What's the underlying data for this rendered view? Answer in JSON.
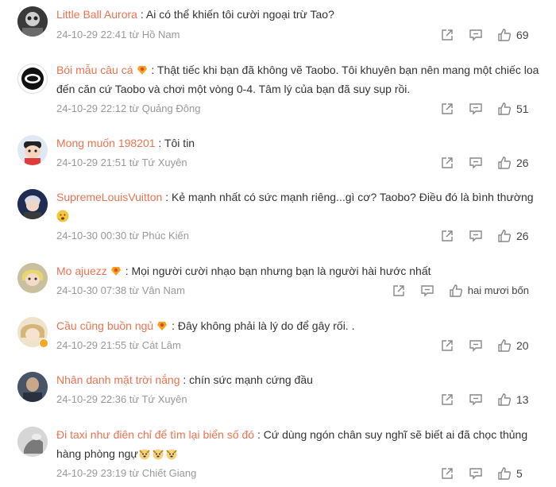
{
  "comments": [
    {
      "user": "Little Ball Aurora",
      "sep": " : ",
      "text": "Ai có thể khiến tôi cười ngoại trừ Tao?",
      "time": "24-10-29 22:41 từ Hồ Nam",
      "likes": "69",
      "badge": false,
      "emojis": []
    },
    {
      "user": "Bói mẫu câu cá",
      "sep": " : ",
      "text": "Thật tiếc khi bạn đã không vẽ Taobo. Tôi khuyên bạn nên mang một chiếc loa đến căn cứ Taobo và chơi một vòng 0-4. Tâm lý của bạn đã suy sụp rồi.",
      "time": "24-10-29 22:12 từ Quảng Đông",
      "likes": "51",
      "badge": true,
      "emojis": []
    },
    {
      "user": "Mong muốn 198201",
      "sep": " : ",
      "text": "Tôi tin",
      "time": "24-10-29 21:51 từ Tứ Xuyên",
      "likes": "26",
      "badge": false,
      "emojis": []
    },
    {
      "user": "SupremeLouisVuitton",
      "sep": " : ",
      "text": "Kẻ mạnh nhất có sức mạnh riêng...gì cơ? Taobo? Điều đó là bình thường",
      "time": "24-10-30 00:30 từ Phúc Kiến",
      "likes": "26",
      "badge": false,
      "emojis": [
        "thinking"
      ]
    },
    {
      "user": "Mo ajuezz",
      "sep": " : ",
      "text": "Mọi người cười nhạo bạn nhưng bạn là người hài hước nhất",
      "time": "24-10-30 07:38 từ Vân Nam",
      "likes": "hai mươi bốn",
      "badge": true,
      "emojis": []
    },
    {
      "user": "Cầu cũng buồn ngủ",
      "sep": " : ",
      "text": "Đây không phải là lý do để gây rối. .",
      "time": "24-10-29 21:55 từ Cát Lâm",
      "likes": "20",
      "badge": true,
      "emojis": []
    },
    {
      "user": "Nhân danh mặt trời nắng",
      "sep": " : ",
      "text": "chín sức mạnh cứng đầu",
      "time": "24-10-29 22:36 từ Tứ Xuyên",
      "likes": "13",
      "badge": false,
      "emojis": []
    },
    {
      "user": "Đi taxi như điên chỉ để tìm lại biển số đó",
      "sep": " : ",
      "text": "Cứ dùng ngón chân suy nghĩ sẽ biết ai đã chọc thủng hàng phòng ngự",
      "time": "24-10-29 23:19 từ Chiết Giang",
      "likes": "5",
      "badge": false,
      "emojis": [
        "dog",
        "dog",
        "dog"
      ]
    }
  ],
  "icons": {
    "share": "share-icon",
    "reply": "reply-icon",
    "like": "like-icon",
    "badge": "fan-badge-icon",
    "verified": "verified-badge-icon"
  },
  "colors": {
    "username": "#eb7350",
    "meta": "#999999",
    "text": "#333333",
    "icon": "#888888"
  }
}
